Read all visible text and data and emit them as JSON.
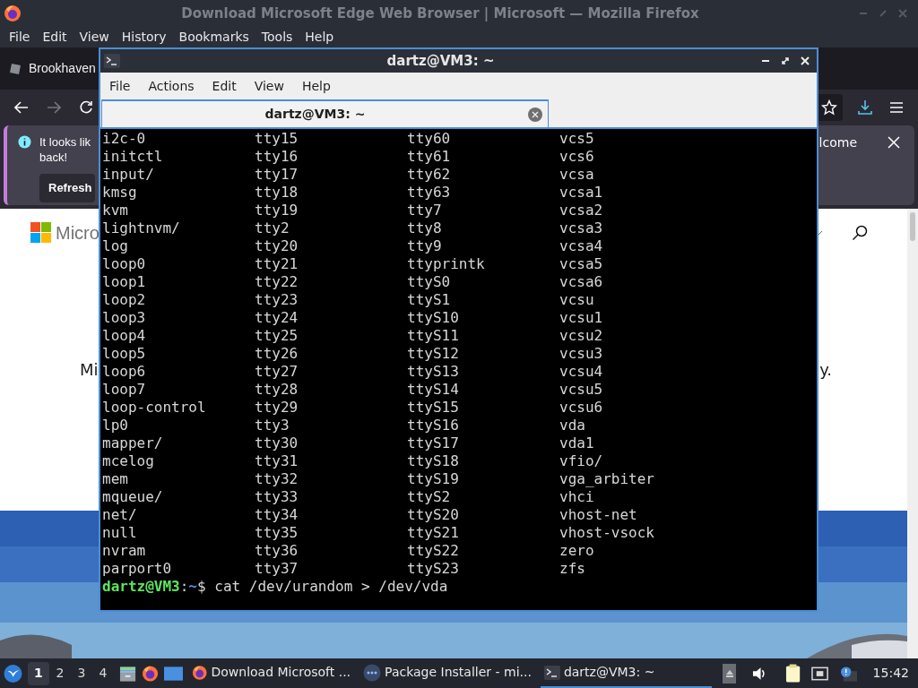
{
  "browser": {
    "title": "Download Microsoft Edge Web Browser | Microsoft — Mozilla Firefox",
    "menu": [
      "File",
      "Edit",
      "View",
      "History",
      "Bookmarks",
      "Tools",
      "Help"
    ],
    "tab": {
      "label": "Brookhaven"
    },
    "notification": {
      "text_start": "It looks lik",
      "text_wrap": "back!",
      "text_end": "lcome",
      "button": "Refresh"
    },
    "page": {
      "logo_text": "Micro",
      "text_left": "Mi",
      "text_right": "y."
    }
  },
  "terminal": {
    "title": "dartz@VM3: ~",
    "menu": [
      "File",
      "Actions",
      "Edit",
      "View",
      "Help"
    ],
    "tab": {
      "label": "dartz@VM3: ~"
    },
    "rows": [
      [
        "i2c-0",
        "tty15",
        "tty60",
        "vcs5"
      ],
      [
        "initctl",
        "tty16",
        "tty61",
        "vcs6"
      ],
      [
        "input/",
        "tty17",
        "tty62",
        "vcsa"
      ],
      [
        "kmsg",
        "tty18",
        "tty63",
        "vcsa1"
      ],
      [
        "kvm",
        "tty19",
        "tty7",
        "vcsa2"
      ],
      [
        "lightnvm/",
        "tty2",
        "tty8",
        "vcsa3"
      ],
      [
        "log",
        "tty20",
        "tty9",
        "vcsa4"
      ],
      [
        "loop0",
        "tty21",
        "ttyprintk",
        "vcsa5"
      ],
      [
        "loop1",
        "tty22",
        "ttyS0",
        "vcsa6"
      ],
      [
        "loop2",
        "tty23",
        "ttyS1",
        "vcsu"
      ],
      [
        "loop3",
        "tty24",
        "ttyS10",
        "vcsu1"
      ],
      [
        "loop4",
        "tty25",
        "ttyS11",
        "vcsu2"
      ],
      [
        "loop5",
        "tty26",
        "ttyS12",
        "vcsu3"
      ],
      [
        "loop6",
        "tty27",
        "ttyS13",
        "vcsu4"
      ],
      [
        "loop7",
        "tty28",
        "ttyS14",
        "vcsu5"
      ],
      [
        "loop-control",
        "tty29",
        "ttyS15",
        "vcsu6"
      ],
      [
        "lp0",
        "tty3",
        "ttyS16",
        "vda"
      ],
      [
        "mapper/",
        "tty30",
        "ttyS17",
        "vda1"
      ],
      [
        "mcelog",
        "tty31",
        "ttyS18",
        "vfio/"
      ],
      [
        "mem",
        "tty32",
        "ttyS19",
        "vga_arbiter"
      ],
      [
        "mqueue/",
        "tty33",
        "ttyS2",
        "vhci"
      ],
      [
        "net/",
        "tty34",
        "ttyS20",
        "vhost-net"
      ],
      [
        "null",
        "tty35",
        "ttyS21",
        "vhost-vsock"
      ],
      [
        "nvram",
        "tty36",
        "ttyS22",
        "zero"
      ],
      [
        "parport0",
        "tty37",
        "ttyS23",
        "zfs"
      ]
    ],
    "prompt": {
      "user": "dartz@VM3",
      "separator": ":",
      "path": "~",
      "command": "$ cat /dev/urandom > /dev/vda"
    }
  },
  "taskbar": {
    "workspaces": [
      {
        "label": "1",
        "selected": true
      },
      {
        "label": "2",
        "selected": false
      },
      {
        "label": "3",
        "selected": false
      },
      {
        "label": "4",
        "selected": false
      }
    ],
    "tasks": [
      {
        "label": "Download Microsoft ...",
        "kind": "firefox",
        "selected": false
      },
      {
        "label": "Package Installer - mi...",
        "kind": "installer",
        "selected": false
      },
      {
        "label": "dartz@VM3: ~",
        "kind": "terminal",
        "selected": true
      }
    ],
    "clock": "15:42"
  }
}
